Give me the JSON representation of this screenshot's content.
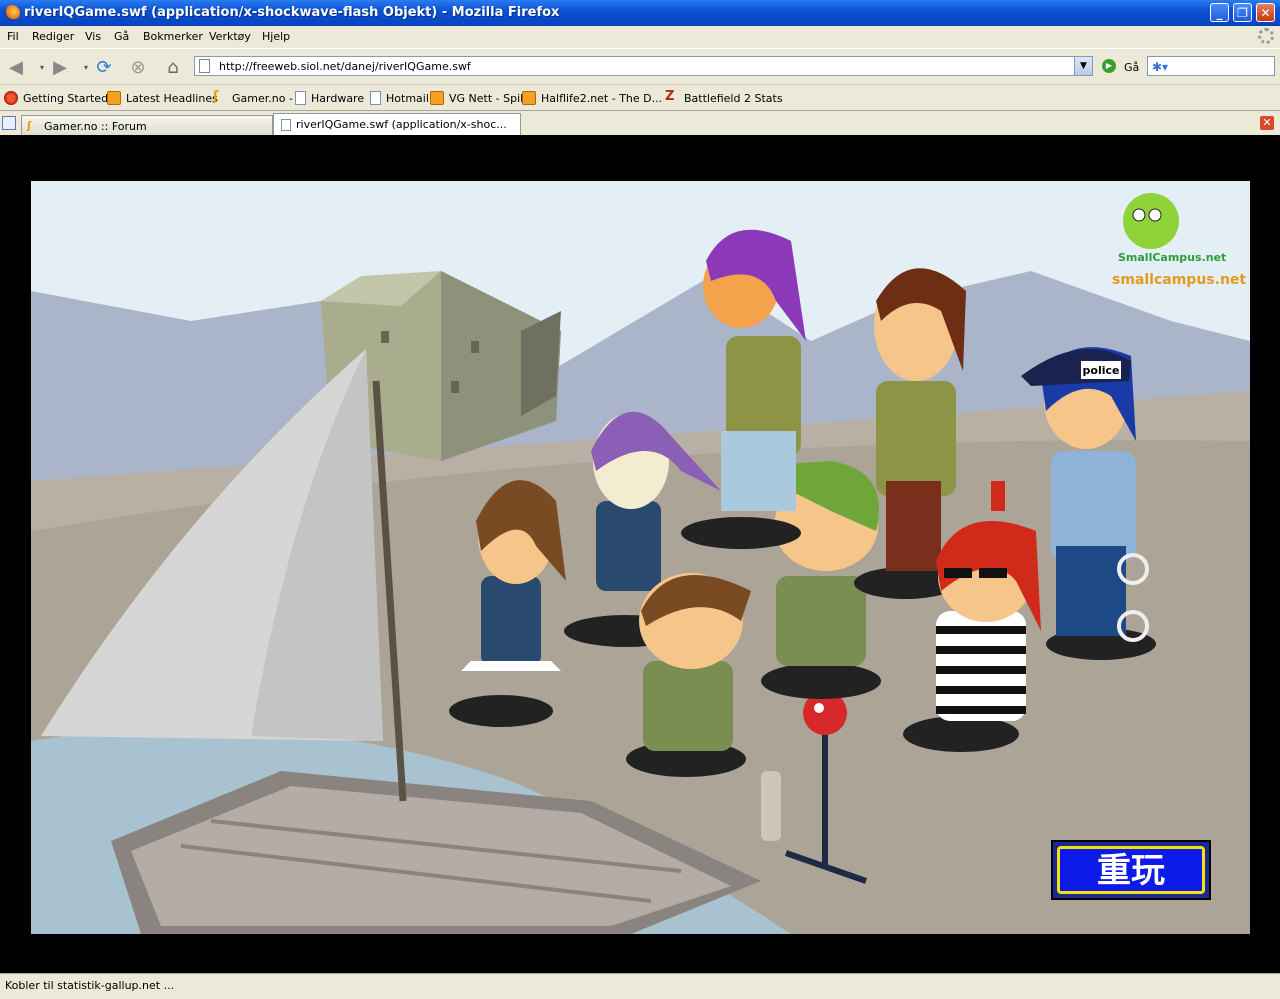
{
  "window": {
    "title": "riverIQGame.swf (application/x-shockwave-flash Objekt) - Mozilla Firefox"
  },
  "menu": {
    "items": [
      "Fil",
      "Rediger",
      "Vis",
      "Gå",
      "Bokmerker",
      "Verktøy",
      "Hjelp"
    ]
  },
  "nav": {
    "url": "http://freeweb.siol.net/danej/riverIQGame.swf",
    "go_label": "Gå"
  },
  "bookmarks": [
    {
      "label": "Getting Started",
      "icon": "firefox-icon"
    },
    {
      "label": "Latest Headlines",
      "icon": "rss-icon"
    },
    {
      "label": "Gamer.no -",
      "icon": "gamer-icon"
    },
    {
      "label": "Hardware",
      "icon": "page-icon"
    },
    {
      "label": "Hotmail",
      "icon": "page-icon"
    },
    {
      "label": "VG Nett - Spill",
      "icon": "rss-icon"
    },
    {
      "label": "Halflife2.net - The D...",
      "icon": "rss-icon"
    },
    {
      "label": "Battlefield 2 Stats",
      "icon": "bf-icon"
    }
  ],
  "tabs": [
    {
      "label": "Gamer.no :: Forum",
      "active": false
    },
    {
      "label": "riverIQGame.swf (application/x-shoc...",
      "active": true
    }
  ],
  "game": {
    "replay_label": "重玩",
    "brand_logo_text": "SmallCampus.net",
    "brand_text": "smallcampus.net",
    "police_cap_text": "police"
  },
  "status": {
    "text": "Kobler til statistik-gallup.net ..."
  }
}
